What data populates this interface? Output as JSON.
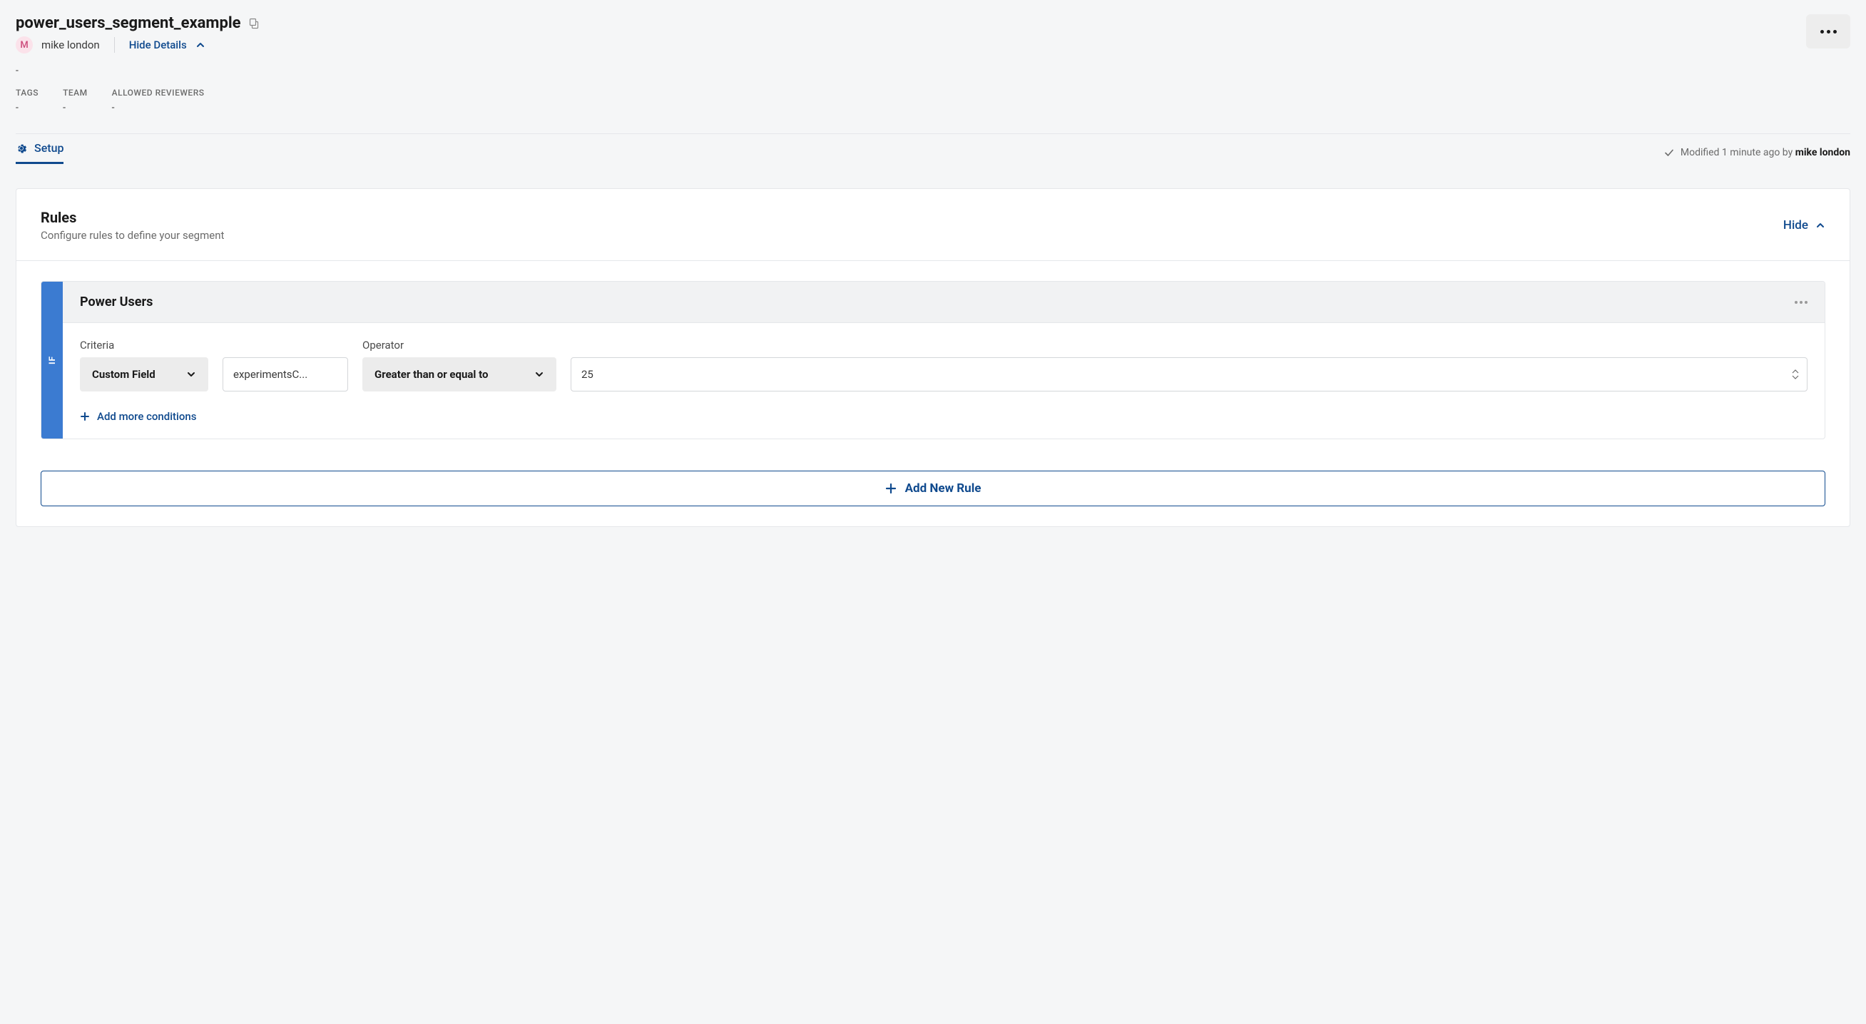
{
  "header": {
    "title": "power_users_segment_example",
    "authorInitial": "M",
    "authorName": "mike london",
    "hideDetailsLabel": "Hide Details",
    "topDash": "-"
  },
  "meta": {
    "tagsLabel": "TAGS",
    "tagsValue": "-",
    "teamLabel": "TEAM",
    "teamValue": "-",
    "reviewersLabel": "ALLOWED REVIEWERS",
    "reviewersValue": "-"
  },
  "tabs": {
    "setup": "Setup"
  },
  "modified": {
    "prefix": "Modified 1 minute ago by ",
    "user": "mike london"
  },
  "rules": {
    "title": "Rules",
    "subtitle": "Configure rules to define your segment",
    "hideLabel": "Hide",
    "ifLabel": "IF",
    "ruleName": "Power Users",
    "criteriaLabel": "Criteria",
    "operatorLabel": "Operator",
    "criteriaSelect": "Custom Field",
    "customFieldValue": "experimentsC...",
    "operatorSelect": "Greater than or equal to",
    "value": "25",
    "addConditions": "Add more conditions",
    "addNewRule": "Add New Rule"
  }
}
